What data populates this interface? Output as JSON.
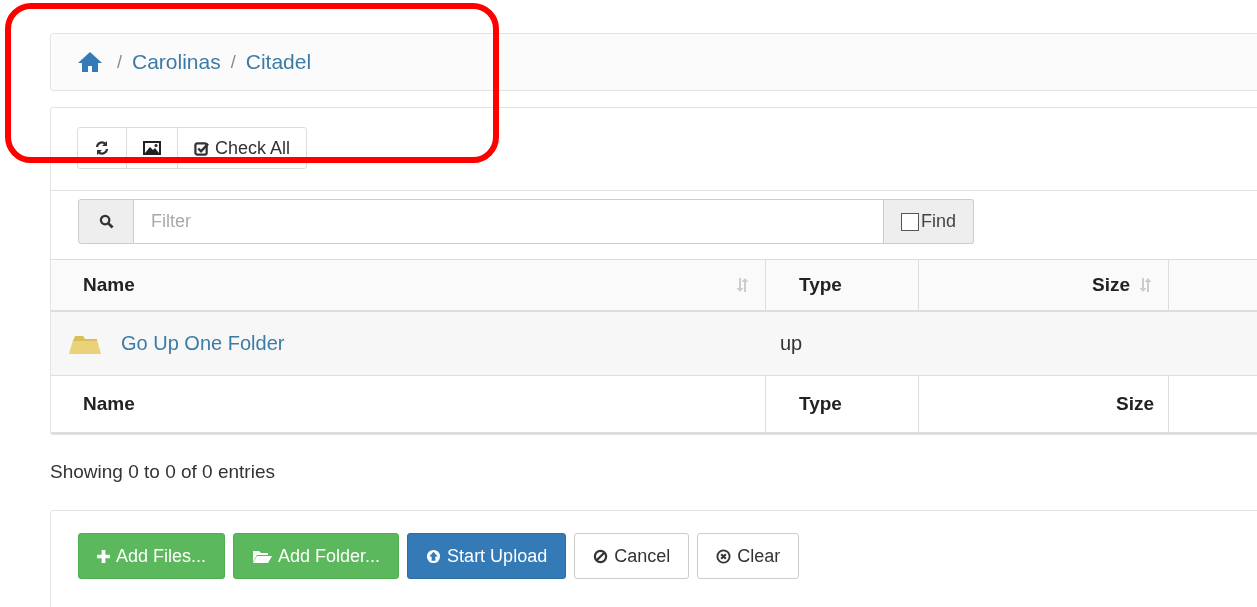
{
  "breadcrumb": [
    {
      "separator": "/",
      "label": "Carolinas"
    },
    {
      "separator": "/",
      "label": "Citadel"
    }
  ],
  "toolbar": {
    "check_all": "Check All"
  },
  "filter": {
    "placeholder": "Filter",
    "find": {
      "label": "Find",
      "checked": false
    }
  },
  "table": {
    "columns": [
      {
        "label": "Name",
        "sortable": true
      },
      {
        "label": "Type",
        "sortable": false
      },
      {
        "label": "Size",
        "sortable": true
      }
    ],
    "rows": [
      {
        "name": "Go Up One Folder",
        "type": "up"
      }
    ],
    "footer": [
      "Name",
      "Type",
      "Size"
    ]
  },
  "status": "Showing 0 to 0 of 0 entries",
  "upload_buttons": [
    {
      "label": "Add Files...",
      "kind": "success"
    },
    {
      "label": "Add Folder...",
      "kind": "success"
    },
    {
      "label": "Start Upload",
      "kind": "primary"
    },
    {
      "label": "Cancel",
      "kind": "default"
    },
    {
      "label": "Clear",
      "kind": "default"
    }
  ]
}
